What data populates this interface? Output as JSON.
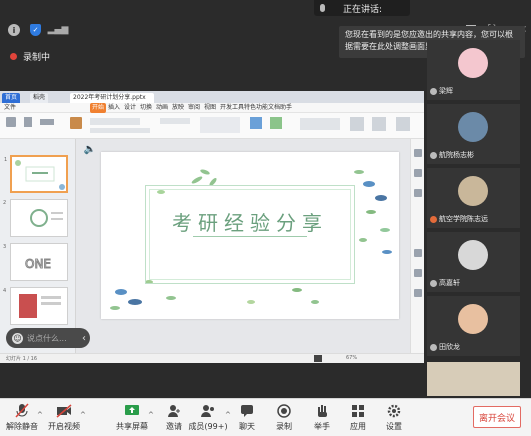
{
  "top": {
    "speaking_text": "正在讲话:",
    "tooltip_text": "您现在看到的是您应邀出的共享内容，您可以根据需要在此处调整画面显示比例",
    "recording_label": "录制中"
  },
  "wps": {
    "tabs": [
      "首页",
      "稻壳",
      "2022年考研计划分享.pptx"
    ],
    "menu": [
      "文件",
      "开始",
      "插入",
      "设计",
      "切换",
      "动画",
      "放映",
      "审阅",
      "视图",
      "开发工具",
      "特色功能",
      "文档助手"
    ],
    "slide_title": "考研经验分享",
    "status": "幻灯片 1 / 16",
    "zoom": "67%"
  },
  "chat": {
    "placeholder": "说点什么..."
  },
  "participants": [
    {
      "name": "梁辉",
      "color": "#f4c7cf"
    },
    {
      "name": "航院杨志彬",
      "color": "#6b8aa8"
    },
    {
      "name": "航空学院陈志远",
      "color": "#c9b79a"
    },
    {
      "name": "高嘉轩",
      "color": "#d8d8d8"
    },
    {
      "name": "田欣龙",
      "color": "#e8c0a0"
    }
  ],
  "toolbar": {
    "unmute": "解除静音",
    "video": "开启视频",
    "share": "共享屏幕",
    "invite": "邀请",
    "members": "成员(99+)",
    "chat": "聊天",
    "record": "录制",
    "raise": "举手",
    "apps": "应用",
    "settings": "设置",
    "leave": "离开会议"
  }
}
